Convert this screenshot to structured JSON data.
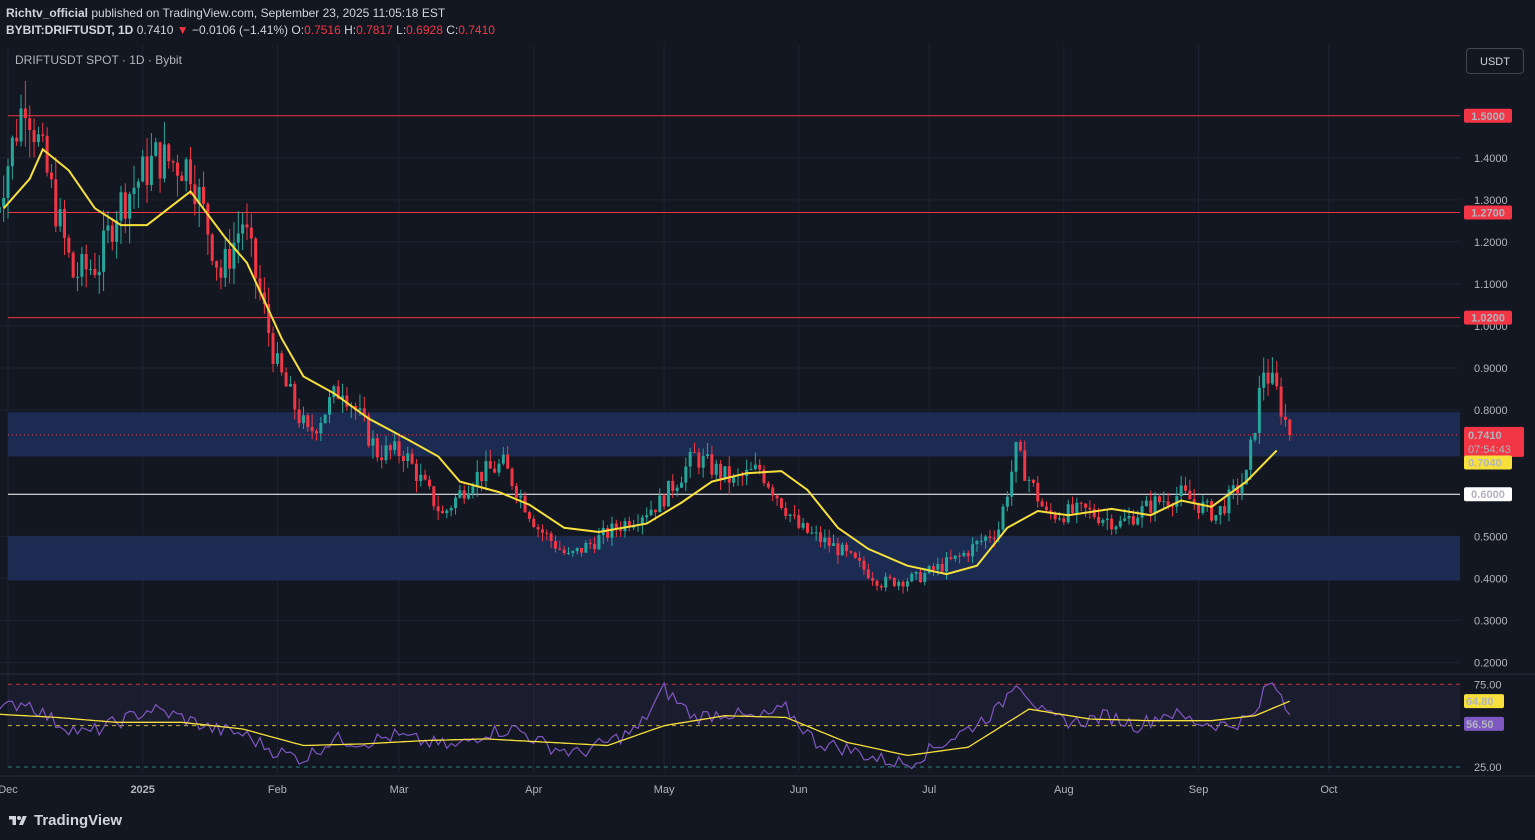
{
  "header": {
    "line1_user": "Richtv_official",
    "line1_rest": " published on TradingView.com, September 23, 2025 11:05:18 EST",
    "symbol": "BYBIT:DRIFTUSDT, 1D",
    "last": "0.7410",
    "change_arrow": "▼",
    "change": "−0.0106 (−1.41%)",
    "o_label": "O:",
    "o_val": "0.7516",
    "h_label": "H:",
    "h_val": "0.7817",
    "l_label": "L:",
    "l_val": "0.6928",
    "c_label": "C:",
    "c_val": "0.7410"
  },
  "chart_label": "DRIFTUSDT SPOT · 1D · Bybit",
  "currency_button": "USDT",
  "footer_brand": "TradingView",
  "colors": {
    "background": "#131722",
    "up": "#26a69a",
    "down": "#f23645",
    "ma": "#f7e03b",
    "resistance": "#f23645",
    "zone": "#1e2f5a",
    "rsi": "#7e57c2",
    "rsi_ma": "#f7e03b"
  },
  "chart_data": [
    {
      "type": "candlestick",
      "title": "DRIFTUSDT SPOT · 1D · Bybit",
      "y_ticks": [
        "1.4000",
        "1.3000",
        "1.2000",
        "1.1000",
        "1.0000",
        "0.9000",
        "0.8000",
        "0.5000",
        "0.4000",
        "0.3000",
        "0.2000"
      ],
      "ylim": [
        0.15,
        1.55
      ],
      "x_ticks": [
        "Dec",
        "2025",
        "Feb",
        "Mar",
        "Apr",
        "May",
        "Jun",
        "Jul",
        "Aug",
        "Sep",
        "Oct"
      ],
      "horizontal_lines": [
        {
          "value": 1.5,
          "label": "1.5000",
          "color": "#f23645"
        },
        {
          "value": 1.27,
          "label": "1.2700",
          "color": "#f23645"
        },
        {
          "value": 1.02,
          "label": "1.0200",
          "color": "#f23645"
        },
        {
          "value": 0.6,
          "label": "0.6000",
          "color": "#ffffff"
        }
      ],
      "zones": [
        {
          "from": 0.69,
          "to": 0.795
        },
        {
          "from": 0.395,
          "to": 0.5
        }
      ],
      "last_price": {
        "value": 0.741,
        "label": "0.7410",
        "countdown": "07:54:43"
      },
      "ma_last": {
        "value": 0.704,
        "label": "0.7040"
      },
      "ma_curve": [
        [
          "Nov 30",
          1.28
        ],
        [
          "Dec 6",
          1.35
        ],
        [
          "Dec 9",
          1.42
        ],
        [
          "Dec 15",
          1.37
        ],
        [
          "Dec 21",
          1.28
        ],
        [
          "Dec 27",
          1.24
        ],
        [
          "Jan 2",
          1.24
        ],
        [
          "Jan 12",
          1.32
        ],
        [
          "Jan 20",
          1.21
        ],
        [
          "Jan 25",
          1.15
        ],
        [
          "Feb 2",
          0.97
        ],
        [
          "Feb 7",
          0.88
        ],
        [
          "Feb 14",
          0.84
        ],
        [
          "Feb 22",
          0.78
        ],
        [
          "Mar 3",
          0.73
        ],
        [
          "Mar 10",
          0.69
        ],
        [
          "Mar 15",
          0.63
        ],
        [
          "Mar 24",
          0.605
        ],
        [
          "Mar 31",
          0.575
        ],
        [
          "Apr 8",
          0.52
        ],
        [
          "Apr 16",
          0.51
        ],
        [
          "Apr 27",
          0.53
        ],
        [
          "May 5",
          0.58
        ],
        [
          "May 12",
          0.63
        ],
        [
          "May 20",
          0.65
        ],
        [
          "May 28",
          0.655
        ],
        [
          "Jun 3",
          0.61
        ],
        [
          "Jun 10",
          0.52
        ],
        [
          "Jun 17",
          0.47
        ],
        [
          "Jun 26",
          0.43
        ],
        [
          "Jul 5",
          0.41
        ],
        [
          "Jul 12",
          0.43
        ],
        [
          "Jul 19",
          0.52
        ],
        [
          "Jul 26",
          0.56
        ],
        [
          "Aug 2",
          0.55
        ],
        [
          "Aug 12",
          0.565
        ],
        [
          "Aug 21",
          0.55
        ],
        [
          "Aug 28",
          0.585
        ],
        [
          "Sep 4",
          0.57
        ],
        [
          "Sep 12",
          0.63
        ],
        [
          "Sep 19",
          0.704
        ]
      ],
      "candles_summary": [
        [
          "Nov 28",
          1.27
        ],
        [
          "Dec 5",
          1.55
        ],
        [
          "Dec 10",
          1.36
        ],
        [
          "Dec 16",
          1.12
        ],
        [
          "Dec 22",
          1.15
        ],
        [
          "Dec 26",
          1.28
        ],
        [
          "Jan 4",
          1.4
        ],
        [
          "Jan 12",
          1.38
        ],
        [
          "Jan 19",
          1.12
        ],
        [
          "Jan 24",
          1.25
        ],
        [
          "Feb 1",
          0.9
        ],
        [
          "Feb 8",
          0.74
        ],
        [
          "Feb 16",
          0.86
        ],
        [
          "Feb 24",
          0.7
        ],
        [
          "Mar 2",
          0.7
        ],
        [
          "Mar 11",
          0.55
        ],
        [
          "Mar 18",
          0.64
        ],
        [
          "Mar 25",
          0.67
        ],
        [
          "Apr 2",
          0.52
        ],
        [
          "Apr 9",
          0.45
        ],
        [
          "Apr 20",
          0.52
        ],
        [
          "Apr 30",
          0.58
        ],
        [
          "May 8",
          0.69
        ],
        [
          "May 17",
          0.63
        ],
        [
          "May 23",
          0.66
        ],
        [
          "Jun 1",
          0.52
        ],
        [
          "Jun 10",
          0.47
        ],
        [
          "Jun 20",
          0.39
        ],
        [
          "Jun 28",
          0.4
        ],
        [
          "Jul 8",
          0.45
        ],
        [
          "Jul 17",
          0.52
        ],
        [
          "Jul 21",
          0.7
        ],
        [
          "Jul 28",
          0.55
        ],
        [
          "Aug 6",
          0.56
        ],
        [
          "Aug 14",
          0.53
        ],
        [
          "Aug 22",
          0.58
        ],
        [
          "Aug 28",
          0.6
        ],
        [
          "Sep 5",
          0.55
        ],
        [
          "Sep 12",
          0.64
        ],
        [
          "Sep 16",
          0.9
        ],
        [
          "Sep 19",
          0.84
        ],
        [
          "Sep 22",
          0.741
        ]
      ]
    },
    {
      "type": "line",
      "title": "",
      "y_ticks": [
        "75.00",
        "50.00",
        "25.00"
      ],
      "ylim": [
        22,
        80
      ],
      "levels": [
        75,
        50,
        25
      ],
      "series": [
        {
          "name": "",
          "last_label": "56.50",
          "values": [
            [
              "Nov 28",
              58
            ],
            [
              "Dec 5",
              65
            ],
            [
              "Dec 12",
              52
            ],
            [
              "Dec 19",
              45
            ],
            [
              "Dec 26",
              52
            ],
            [
              "Jan 3",
              60
            ],
            [
              "Jan 10",
              55
            ],
            [
              "Jan 17",
              48
            ],
            [
              "Jan 24",
              45
            ],
            [
              "Jan 31",
              35
            ],
            [
              "Feb 7",
              30
            ],
            [
              "Feb 14",
              42
            ],
            [
              "Feb 21",
              40
            ],
            [
              "Feb 28",
              44
            ],
            [
              "Mar 7",
              40
            ],
            [
              "Mar 14",
              37
            ],
            [
              "Mar 21",
              46
            ],
            [
              "Mar 28",
              48
            ],
            [
              "Apr 4",
              38
            ],
            [
              "Apr 11",
              33
            ],
            [
              "Apr 18",
              40
            ],
            [
              "Apr 25",
              48
            ],
            [
              "May 1",
              72
            ],
            [
              "May 8",
              55
            ],
            [
              "May 15",
              58
            ],
            [
              "May 22",
              54
            ],
            [
              "May 29",
              60
            ],
            [
              "Jun 5",
              40
            ],
            [
              "Jun 12",
              36
            ],
            [
              "Jun 19",
              30
            ],
            [
              "Jun 26",
              27
            ],
            [
              "Jul 3",
              38
            ],
            [
              "Jul 10",
              48
            ],
            [
              "Jul 17",
              60
            ],
            [
              "Jul 21",
              78
            ],
            [
              "Jul 28",
              55
            ],
            [
              "Aug 4",
              52
            ],
            [
              "Aug 11",
              56
            ],
            [
              "Aug 18",
              50
            ],
            [
              "Aug 25",
              58
            ],
            [
              "Sep 1",
              52
            ],
            [
              "Sep 8",
              50
            ],
            [
              "Sep 14",
              56
            ],
            [
              "Sep 17",
              76
            ],
            [
              "Sep 20",
              70
            ],
            [
              "Sep 22",
              56.5
            ]
          ]
        },
        {
          "name": "",
          "last_label": "64.80",
          "values": [
            [
              "Nov 28",
              57
            ],
            [
              "Dec 12",
              55
            ],
            [
              "Dec 26",
              52
            ],
            [
              "Jan 10",
              52
            ],
            [
              "Jan 24",
              48
            ],
            [
              "Feb 7",
              38
            ],
            [
              "Feb 21",
              39
            ],
            [
              "Mar 7",
              41
            ],
            [
              "Mar 21",
              42
            ],
            [
              "Apr 4",
              40
            ],
            [
              "Apr 18",
              38
            ],
            [
              "May 1",
              50
            ],
            [
              "May 15",
              56
            ],
            [
              "May 29",
              55
            ],
            [
              "Jun 12",
              40
            ],
            [
              "Jun 26",
              32
            ],
            [
              "Jul 10",
              37
            ],
            [
              "Jul 24",
              60
            ],
            [
              "Aug 7",
              54
            ],
            [
              "Aug 21",
              53
            ],
            [
              "Sep 4",
              53
            ],
            [
              "Sep 14",
              56
            ],
            [
              "Sep 22",
              64.8
            ]
          ]
        }
      ]
    }
  ]
}
